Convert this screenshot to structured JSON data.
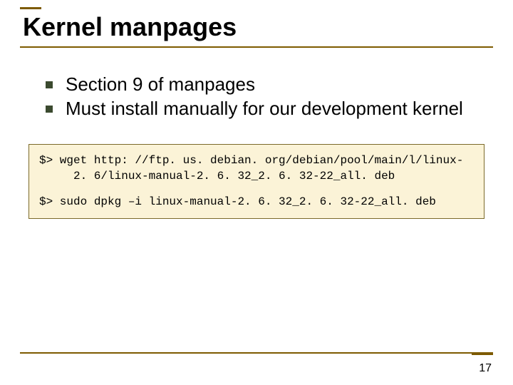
{
  "title": "Kernel manpages",
  "bullets": [
    "Section 9 of manpages",
    "Must install manually for our development kernel"
  ],
  "code": {
    "line1a": "$> wget http: //ftp. us. debian. org/debian/pool/main/l/linux-",
    "line1b": "2. 6/linux-manual-2. 6. 32_2. 6. 32-22_all. deb",
    "line2": "$> sudo dpkg –i linux-manual-2. 6. 32_2. 6. 32-22_all. deb"
  },
  "page_number": "17"
}
